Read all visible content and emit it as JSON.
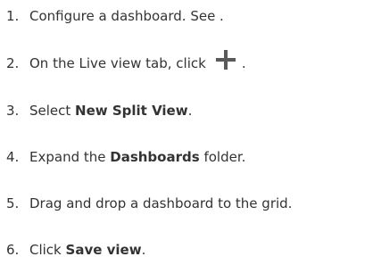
{
  "steps": [
    {
      "number": "1.",
      "text": "Configure a dashboard. See ."
    },
    {
      "number": "2.",
      "before": "On the Live view tab, click",
      "after": ".",
      "icon": "plus-icon",
      "icon_color": "#5a5a5a"
    },
    {
      "number": "3.",
      "before": "Select ",
      "bold": "New Split View",
      "after": "."
    },
    {
      "number": "4.",
      "before": "Expand the ",
      "bold": "Dashboards",
      "after": " folder."
    },
    {
      "number": "5.",
      "text": "Drag and drop a dashboard to the grid."
    },
    {
      "number": "6.",
      "before": "Click ",
      "bold": "Save view",
      "after": "."
    }
  ]
}
